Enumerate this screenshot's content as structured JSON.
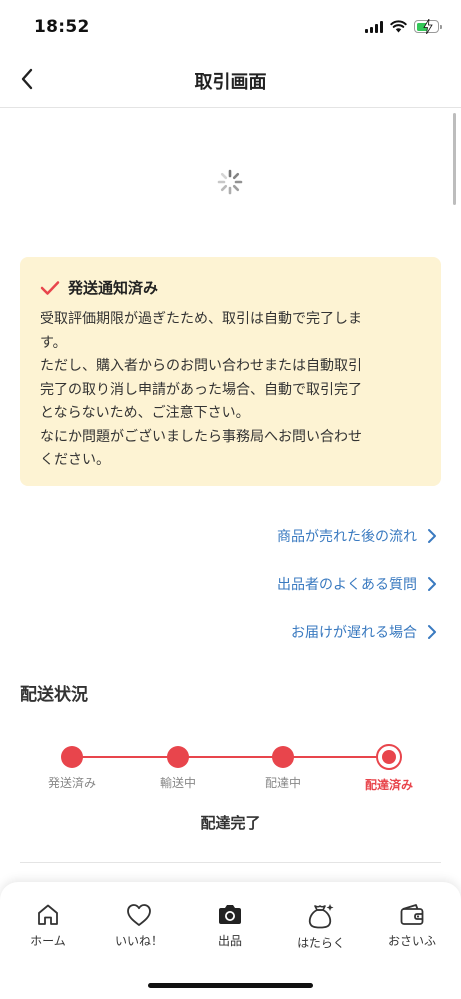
{
  "status_bar": {
    "time": "18:52",
    "icons": [
      "signal-icon",
      "wifi-icon",
      "battery-icon"
    ],
    "battery_color": "#34c759"
  },
  "header": {
    "title": "取引画面",
    "back_icon": "chevron-left-icon"
  },
  "notice": {
    "icon": "checkmark-icon",
    "title": "発送通知済み",
    "body": "受取評価期限が過ぎたため、取引は自動で完了しま\nす。\nただし、購入者からのお問い合わせまたは自動取引\n完了の取り消し申請があった場合、自動で取引完了\nとならないため、ご注意下さい。\nなにか問題がございましたら事務局へお問い合わせ\nください。",
    "background_color": "#fdf3d3",
    "accent_color": "#e8454c"
  },
  "help_links": [
    {
      "label": "商品が売れた後の流れ"
    },
    {
      "label": "出品者のよくある質問"
    },
    {
      "label": "お届けが遅れる場合"
    }
  ],
  "delivery": {
    "section_title": "配送状況",
    "steps": [
      {
        "label": "発送済み",
        "current": false
      },
      {
        "label": "輸送中",
        "current": false
      },
      {
        "label": "配達中",
        "current": false
      },
      {
        "label": "配達済み",
        "current": true
      }
    ],
    "status_text": "配達完了",
    "progress_color": "#e8454c"
  },
  "tab_bar": {
    "items": [
      {
        "label": "ホーム",
        "icon": "home-icon"
      },
      {
        "label": "いいね！",
        "icon": "heart-icon"
      },
      {
        "label": "出品",
        "icon": "camera-icon"
      },
      {
        "label": "はたらく",
        "icon": "money-bag-icon"
      },
      {
        "label": "おさいふ",
        "icon": "wallet-icon"
      }
    ]
  },
  "colors": {
    "link": "#3a7ac0",
    "accent": "#e8454c"
  }
}
